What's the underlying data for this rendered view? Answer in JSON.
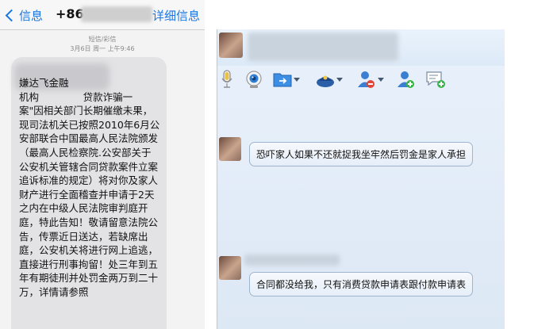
{
  "sms": {
    "back_label": "信息",
    "number_prefix": "+86",
    "details_label": "详细信息",
    "message_type": "短信/彩信",
    "timestamp": "3月6日 周一 上午9:46",
    "message_text": "嫌达飞金融\n机构              贷款诈骗一\n案\"因相关部门长期催缴未果，现司法机关已按照2010年6月公安部联合中国最高人民法院颁发（最高人民检察院.公安部关于公安机关管辖合同贷款案件立案追诉标准的规定）将对你及家人财产进行全面稽查并申请于2天之内在中级人民法院审判庭开庭，特此告知！敬请留意法院公告，传票近日送达，若缺席出庭，公安机关将进行网上追逃，直接进行刑事拘留！处三年到五年有期徒刑并处罚金两万到二十万，详情请参照"
  },
  "chat": {
    "colors": {
      "accent": "#1a76e0",
      "bubble_border": "#9fb5cf",
      "panel_bg": "#e3ecf7"
    },
    "toolbar_icons": [
      "microphone-icon",
      "webcam-icon",
      "folder-transfer-icon",
      "remote-assist-icon",
      "block-user-icon",
      "add-contact-icon",
      "message-add-icon"
    ],
    "messages": [
      {
        "text": "恐吓家人如果不还就捉我坐牢然后罚金是家人承担"
      },
      {
        "text": "合同都没给我，只有消费贷款申请表跟付款申请表"
      }
    ]
  }
}
